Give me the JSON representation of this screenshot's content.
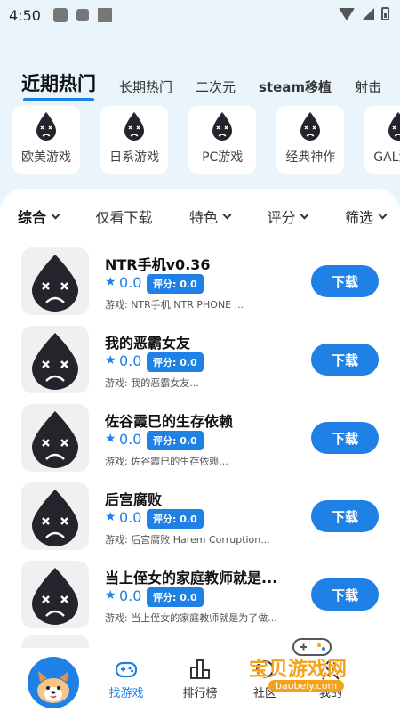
{
  "status_bar": {
    "time": "4:50"
  },
  "top_tabs": [
    {
      "label": "近期热门",
      "active": true
    },
    {
      "label": "长期热门",
      "active": false
    },
    {
      "label": "二次元",
      "active": false
    },
    {
      "label": "steam移植",
      "active": false
    },
    {
      "label": "射击",
      "active": false
    }
  ],
  "categories": [
    {
      "label": "欧美游戏"
    },
    {
      "label": "日系游戏"
    },
    {
      "label": "PC游戏"
    },
    {
      "label": "经典神作"
    },
    {
      "label": "GAL游戏"
    }
  ],
  "filters": [
    {
      "label": "综合",
      "dropdown": true
    },
    {
      "label": "仅看下载",
      "dropdown": false
    },
    {
      "label": "特色",
      "dropdown": true
    },
    {
      "label": "评分",
      "dropdown": true
    },
    {
      "label": "筛选",
      "dropdown": true
    }
  ],
  "games": [
    {
      "title": "NTR手机v0.36",
      "rating": "0.0",
      "score_label": "评分: 0.0",
      "desc": "游戏: NTR手机   NTR PHONE ...",
      "button": "下载"
    },
    {
      "title": "我的恶霸女友",
      "rating": "0.0",
      "score_label": "评分: 0.0",
      "desc": "游戏: 我的恶霸女友...",
      "button": "下载"
    },
    {
      "title": "佐谷霞巳的生存依赖",
      "rating": "0.0",
      "score_label": "评分: 0.0",
      "desc": "游戏:  佐谷霞巳的生存依赖...",
      "button": "下载"
    },
    {
      "title": "后宫腐败",
      "rating": "0.0",
      "score_label": "评分: 0.0",
      "desc": "游戏: 后宫腐败   Harem Corruption...",
      "button": "下载"
    },
    {
      "title": "当上侄女的家庭教师就是...",
      "rating": "0.0",
      "score_label": "评分: 0.0",
      "desc": "游戏: 当上侄女的家庭教师就是为了做...",
      "button": "下载"
    }
  ],
  "bottom_nav": [
    {
      "label": "找游戏",
      "icon": "gamepad-icon",
      "active": true
    },
    {
      "label": "排行榜",
      "icon": "ranking-chart-icon",
      "active": false
    },
    {
      "label": "社区",
      "icon": "community-icon",
      "active": false
    },
    {
      "label": "我的",
      "icon": "profile-icon",
      "active": false
    }
  ],
  "watermark": {
    "text": "宝贝游戏网",
    "url": "baobeiy.com"
  },
  "colors": {
    "accent": "#1f80e6",
    "background": "#e9f4fb",
    "watermark": "#f5a21b"
  }
}
